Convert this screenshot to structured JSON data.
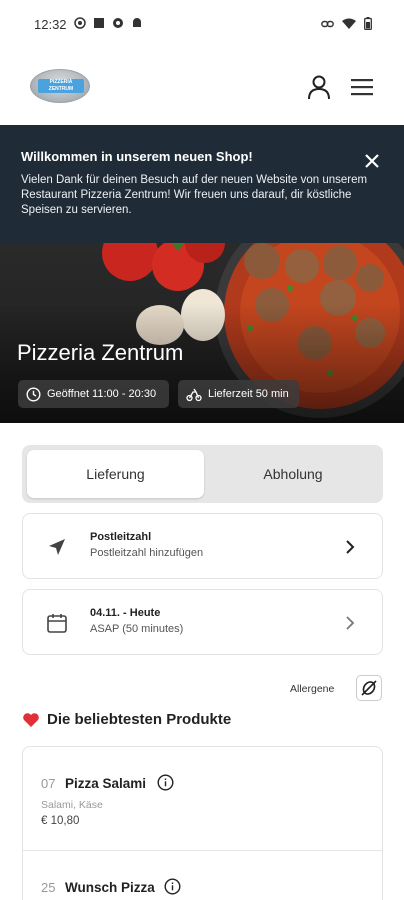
{
  "status_bar": {
    "time": "12:32",
    "left_icons": [
      "whatsapp-icon",
      "square-icon",
      "settings-icon",
      "android-icon"
    ],
    "right_icons": [
      "link-icon",
      "wifi-icon",
      "battery-icon"
    ]
  },
  "header": {
    "logo_text_top": "PIZZERIA",
    "logo_text_bottom": "ZENTRUM",
    "icons": [
      "user-icon",
      "menu-icon"
    ]
  },
  "banner": {
    "title": "Willkommen in unserem neuen Shop!",
    "text": "Vielen Dank für deinen Besuch auf der neuen Website von unserem Restaurant Pizzeria Zentrum! Wir freuen uns darauf, dir köstliche Speisen zu servieren.",
    "close_icon": "close-icon"
  },
  "hero": {
    "title": "Pizzeria Zentrum",
    "opening_hours": "Geöffnet 11:00 - 20:30",
    "delivery_time": "Lieferzeit 50 min"
  },
  "order_mode": {
    "delivery": "Lieferung",
    "pickup": "Abholung",
    "selected": "Lieferung"
  },
  "postcode_card": {
    "title": "Postleitzahl",
    "subtitle": "Postleitzahl hinzufügen"
  },
  "date_card": {
    "title": "04.11. - Heute",
    "subtitle": "ASAP (50 minutes)"
  },
  "allergens_label": "Allergene",
  "popular": {
    "heading": "Die beliebtesten Produkte",
    "products": [
      {
        "number": "07",
        "name": "Pizza Salami",
        "description": "Salami, Käse",
        "price": "€ 10,80"
      },
      {
        "number": "25",
        "name": "Wunsch Pizza",
        "description": "",
        "price": ""
      }
    ]
  },
  "colors": {
    "banner_bg": "#1f2b36",
    "heart": "#e0303a",
    "logo_blue": "#4aa3df"
  }
}
